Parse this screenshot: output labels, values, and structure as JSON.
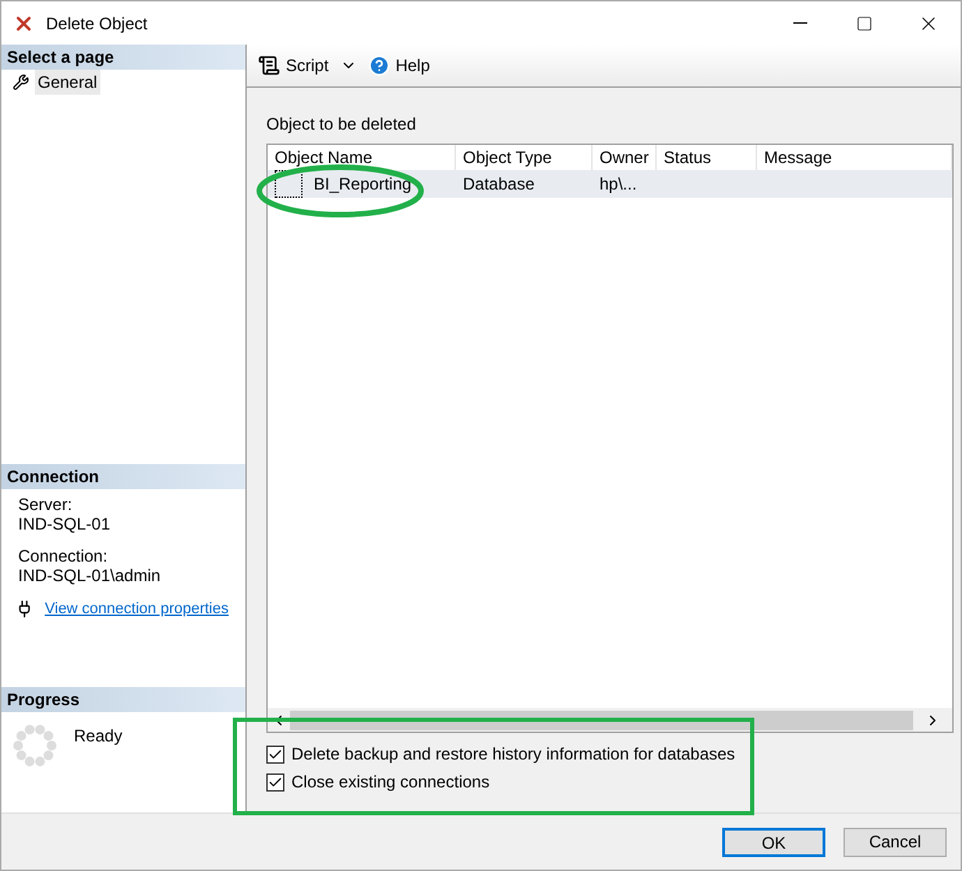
{
  "window": {
    "title": "Delete Object"
  },
  "sidebar": {
    "select_header": "Select a page",
    "pages": [
      {
        "label": "General",
        "selected": true
      }
    ],
    "connection_header": "Connection",
    "server_label": "Server:",
    "server": "IND-SQL-01",
    "connection_label": "Connection:",
    "connection": "IND-SQL-01\\admin",
    "link": "View connection properties",
    "progress_header": "Progress",
    "progress_status": "Ready"
  },
  "toolbar": {
    "script": "Script",
    "help": "Help"
  },
  "group_label": "Object to be deleted",
  "table": {
    "columns": [
      "Object Name",
      "Object Type",
      "Owner",
      "Status",
      "Message"
    ],
    "rows": [
      {
        "cells": [
          "BI_Reporting",
          "Database",
          "hp\\...",
          "",
          ""
        ],
        "selected": true
      }
    ]
  },
  "options": [
    {
      "label": "Delete backup and restore history information for databases",
      "checked": true
    },
    {
      "label": "Close existing connections",
      "checked": true
    }
  ],
  "buttons": [
    {
      "label": "OK",
      "default": true
    },
    {
      "label": "Cancel",
      "default": false
    }
  ]
}
